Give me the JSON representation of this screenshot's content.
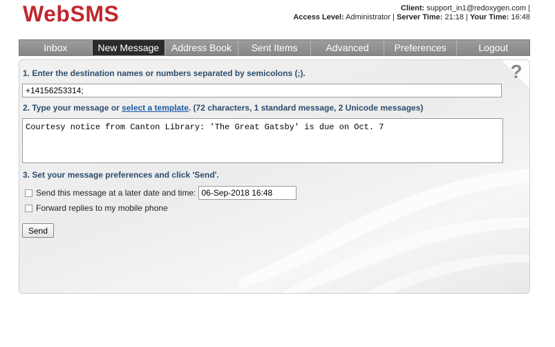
{
  "app": {
    "logo": "WebSMS"
  },
  "header": {
    "client_label": "Client:",
    "client_value": "support_in1@redoxygen.com |",
    "access_label": "Access Level:",
    "access_value": "Administrator |",
    "server_label": "Server Time:",
    "server_value": "21:18 |",
    "your_label": "Your Time:",
    "your_value": "16:48"
  },
  "nav": {
    "tabs": [
      {
        "label": "Inbox"
      },
      {
        "label": "New Message"
      },
      {
        "label": "Address Book"
      },
      {
        "label": "Sent Items"
      },
      {
        "label": "Advanced"
      },
      {
        "label": "Preferences"
      },
      {
        "label": "Logout"
      }
    ],
    "active_index": 1
  },
  "form": {
    "step1": "1. Enter the destination names or numbers separated by semicolons (;).",
    "destination_value": "+14156253314;",
    "step2_prefix": "2. Type your message or ",
    "step2_link": "select a template",
    "step2_suffix": ". (72 characters, 1 standard message, 2 Unicode messages)",
    "message_value": "Courtesy notice from Canton Library: 'The Great Gatsby' is due on Oct. 7",
    "step3": "3. Set your message preferences and click 'Send'.",
    "later_label": "Send this message at a later date and time:",
    "later_value": "06-Sep-2018 16:48",
    "forward_label": "Forward replies to my mobile phone",
    "send_label": "Send",
    "help_glyph": "?"
  },
  "colors": {
    "logo": "#c0282e",
    "nav_active": "#2b2b2b",
    "nav_bg": "#8d8d8d",
    "step_text": "#2c4d6e",
    "link": "#1a5aa8"
  }
}
